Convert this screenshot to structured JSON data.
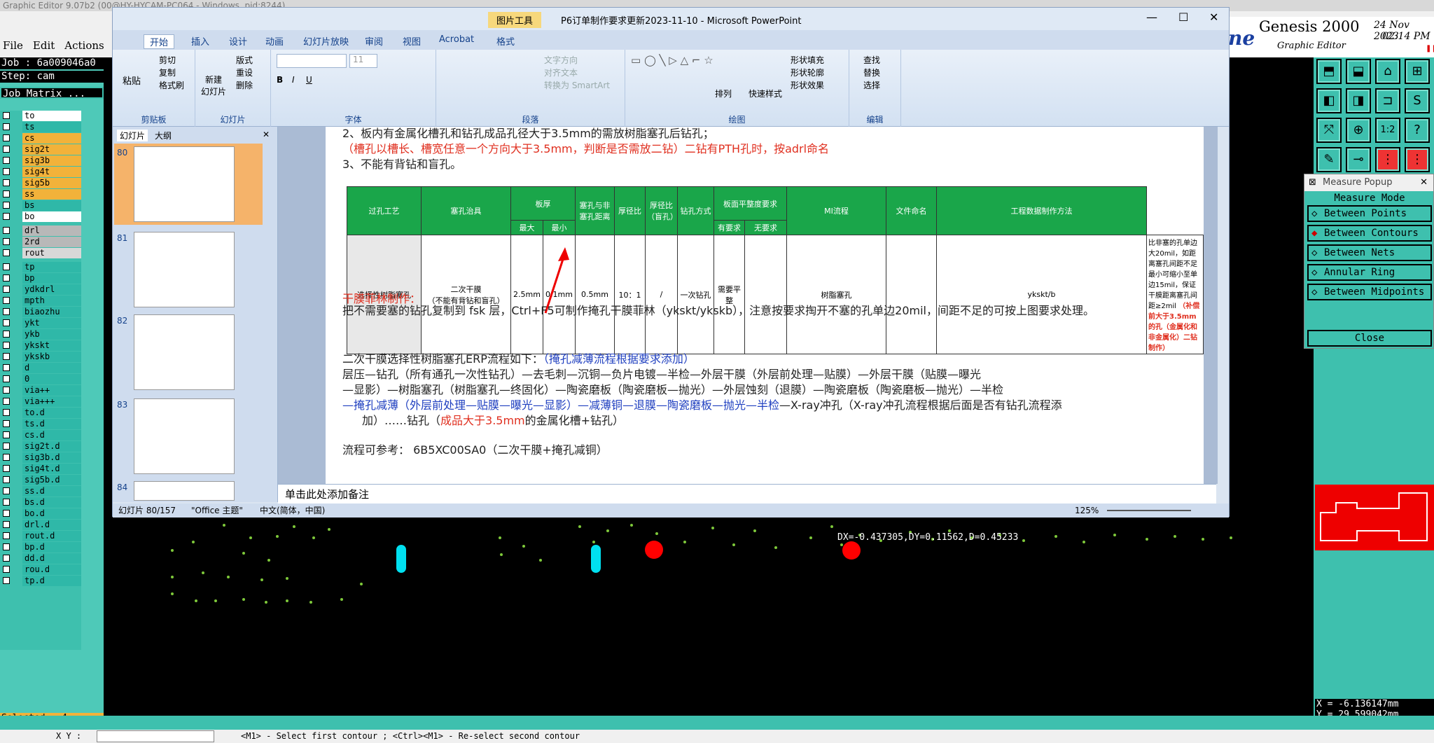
{
  "genesis": {
    "title": "Graphic Editor 9.07b2 (00@HY-HYCAM-PC064 - Windows, pid:8244)",
    "menu": [
      "File",
      "Edit",
      "Actions"
    ],
    "brand": "Genesis 2000",
    "brand_sub": "Graphic Editor",
    "date": "24 Nov 2023",
    "time": "02:14 PM",
    "job": "Job : 6a009046a0",
    "step": "Step: cam",
    "job_matrix": "Job Matrix ...",
    "layers": [
      {
        "name": "to",
        "color": "#ffffff"
      },
      {
        "name": "ts",
        "color": "#2fb8a8"
      },
      {
        "name": "cs",
        "color": "#f2b23a"
      },
      {
        "name": "sig2t",
        "color": "#f2b23a"
      },
      {
        "name": "sig3b",
        "color": "#f2b23a"
      },
      {
        "name": "sig4t",
        "color": "#f2b23a"
      },
      {
        "name": "sig5b",
        "color": "#f2b23a"
      },
      {
        "name": "ss",
        "color": "#f2b23a"
      },
      {
        "name": "bs",
        "color": "#2fb8a8"
      },
      {
        "name": "bo",
        "color": "#ffffff"
      },
      {
        "name": "drl",
        "color": "#b8b8b8"
      },
      {
        "name": "2rd",
        "color": "#b8b8b8"
      },
      {
        "name": "rout",
        "color": "#d8d8d8"
      },
      {
        "name": "tp",
        "color": "#2fb8a8"
      },
      {
        "name": "bp",
        "color": "#2fb8a8"
      },
      {
        "name": "ydkdrl",
        "color": "#2fb8a8"
      },
      {
        "name": "mpth",
        "color": "#2fb8a8"
      },
      {
        "name": "biaozhu",
        "color": "#2fb8a8"
      },
      {
        "name": "ykt",
        "color": "#2fb8a8"
      },
      {
        "name": "ykb",
        "color": "#2fb8a8"
      },
      {
        "name": "ykskt",
        "color": "#2fb8a8"
      },
      {
        "name": "ykskb",
        "color": "#2fb8a8"
      },
      {
        "name": "d",
        "color": "#2fb8a8"
      },
      {
        "name": "0",
        "color": "#2fb8a8"
      },
      {
        "name": "via++",
        "color": "#2fb8a8"
      },
      {
        "name": "via+++",
        "color": "#2fb8a8"
      },
      {
        "name": "to.d",
        "color": "#2fb8a8"
      },
      {
        "name": "ts.d",
        "color": "#2fb8a8"
      },
      {
        "name": "cs.d",
        "color": "#2fb8a8"
      },
      {
        "name": "sig2t.d",
        "color": "#2fb8a8"
      },
      {
        "name": "sig3b.d",
        "color": "#2fb8a8"
      },
      {
        "name": "sig4t.d",
        "color": "#2fb8a8"
      },
      {
        "name": "sig5b.d",
        "color": "#2fb8a8"
      },
      {
        "name": "ss.d",
        "color": "#2fb8a8"
      },
      {
        "name": "bs.d",
        "color": "#2fb8a8"
      },
      {
        "name": "bo.d",
        "color": "#2fb8a8"
      },
      {
        "name": "drl.d",
        "color": "#2fb8a8"
      },
      {
        "name": "rout.d",
        "color": "#2fb8a8"
      },
      {
        "name": "bp.d",
        "color": "#2fb8a8"
      },
      {
        "name": "dd.d",
        "color": "#2fb8a8"
      },
      {
        "name": "rou.d",
        "color": "#2fb8a8"
      },
      {
        "name": "tp.d",
        "color": "#2fb8a8"
      }
    ],
    "selected": "Selected : 4",
    "measure": {
      "title": "Measure Popup",
      "mode": "Measure Mode",
      "options": [
        "Between Points",
        "Between Contours",
        "Between Nets",
        "Annular Ring",
        "Between Midpoints"
      ],
      "selected": "Between Contours",
      "close": "Close"
    },
    "canvas_readout": "DX=-0.437305,DY=0.11562,D=0.45233",
    "coord_x": "X = -6.136147mm",
    "coord_y": "Y = 29.599042mm",
    "xy_label": "X Y :",
    "status": "<M1> - Select first contour ; <Ctrl><M1> - Re-select second contour"
  },
  "ppt": {
    "title": "P6订单制作要求更新2023-11-10 - Microsoft PowerPoint",
    "context_tab": "图片工具",
    "tabs": [
      "开始",
      "插入",
      "设计",
      "动画",
      "幻灯片放映",
      "审阅",
      "视图",
      "Acrobat",
      "格式"
    ],
    "ribbon": {
      "clipboard": {
        "paste": "粘贴",
        "cut": "剪切",
        "copy": "复制",
        "format_painter": "格式刷",
        "label": "剪贴板"
      },
      "slides": {
        "new_slide": "新建\n幻灯片",
        "layout": "版式",
        "reset": "重设",
        "delete": "删除",
        "label": "幻灯片"
      },
      "font": {
        "size": "11",
        "label": "字体"
      },
      "paragraph": {
        "text_dir": "文字方向",
        "align_text": "对齐文本",
        "smartart": "转换为 SmartArt",
        "label": "段落"
      },
      "drawing": {
        "arrange": "排列",
        "quick_styles": "快速样式",
        "fill": "形状填充",
        "outline": "形状轮廓",
        "effects": "形状效果",
        "label": "绘图"
      },
      "editing": {
        "find": "查找",
        "replace": "替换",
        "select": "选择",
        "label": "编辑"
      }
    },
    "panel_tabs": [
      "幻灯片",
      "大纲"
    ],
    "thumbs": [
      "80",
      "81",
      "82",
      "83",
      "84"
    ],
    "slide": {
      "line1": "2、板内有金属化槽孔和钻孔成品孔径大于3.5mm的需放树脂塞孔后钻孔；",
      "line2": "（槽孔以槽长、槽宽任意一个方向大于3.5mm，判断是否需放二钻）二钻有PTH孔时，按adrl命名",
      "line3": "3、不能有背钻和盲孔。",
      "table_head": [
        "过孔工艺",
        "塞孔治具",
        "板厚",
        "塞孔与非塞孔距离",
        "厚径比",
        "厚径比（盲孔）",
        "钻孔方式",
        "板面平整度要求",
        "MI流程",
        "文件命名",
        "工程数据制作方法"
      ],
      "table_sub": [
        "最大",
        "最小",
        "有要求",
        "无要求"
      ],
      "table_row": [
        "选择性树脂塞孔",
        "二次干膜\n（不能有背钻和盲孔）",
        "2.5mm",
        "0.1mm",
        "0.5mm",
        "10：1",
        "/",
        "一次钻孔",
        "需要平整",
        "",
        "树脂塞孔",
        "",
        "ykskt/b",
        "比非塞的孔单边大20mil，如距离塞孔间距不足最小可缩小至单边15mil，保证干膜距离塞孔间距≥2mil"
      ],
      "table_note": "（补偿前大于3.5mm的孔（金属化和非金属化）二钻制作）",
      "dry_title": "干膜菲林制作：",
      "dry_text": "把不需要塞的钻孔复制到 fsk 层，Ctrl+F5可制作掩孔干膜菲林（ykskt/ykskb），注意按要求掏开不塞的孔单边20mil，间距不足的可按上图要求处理。",
      "flow_title": "二次干膜选择性树脂塞孔ERP流程如下：",
      "flow_title_note": "（掩孔减薄流程根据要求添加）",
      "flow1": "层压—钻孔（所有通孔一次性钻孔）—去毛刺—沉铜—负片电镀—半检—外层干膜（外层前处理—贴膜）—外层干膜（贴膜—曝光",
      "flow2": "—显影）—树脂塞孔（树脂塞孔—终固化）—陶瓷磨板（陶瓷磨板—抛光）—外层蚀刻（退膜）—陶瓷磨板（陶瓷磨板—抛光）—半检",
      "flow3a": "—掩孔减薄（外层前处理—贴膜—曝光—显影）—减薄铜—退膜—陶瓷磨板—抛光—半检",
      "flow3b": "—X-ray冲孔（X-ray冲孔流程根据后面是否有钻孔流程添",
      "flow4a": "加）……钻孔（",
      "flow4b": "成品大于3.5mm",
      "flow4c": "的金属化槽+钻孔）",
      "ref": "流程可参考：  6B5XC00SA0（二次干膜+掩孔减铜）"
    },
    "notes": "单击此处添加备注",
    "status": {
      "slide": "幻灯片 80/157",
      "theme": "\"Office 主题\"",
      "lang": "中文(简体，中国)",
      "zoom": "125%"
    }
  }
}
